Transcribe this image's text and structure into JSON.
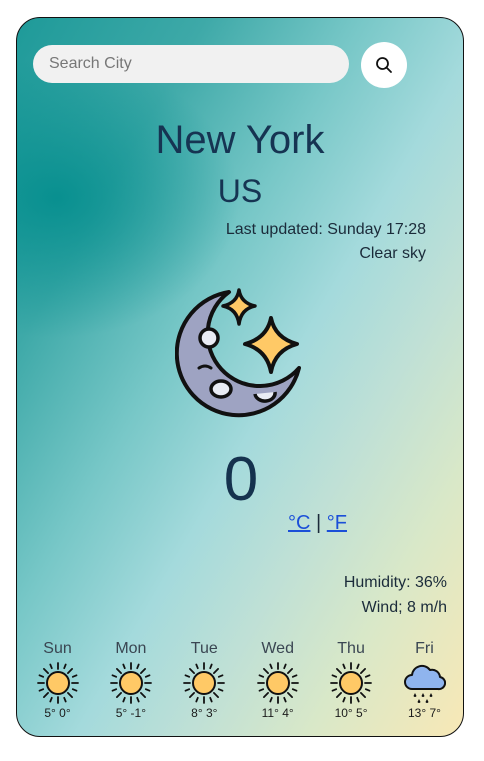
{
  "search": {
    "placeholder": "Search City",
    "value": ""
  },
  "location": {
    "city": "New York",
    "country": "US"
  },
  "current": {
    "last_updated": "Last updated: Sunday 17:28",
    "description": "Clear sky",
    "icon": "crescent-moon-stars-icon",
    "temperature": "0",
    "unit_celsius": "°C",
    "unit_separator": "|",
    "unit_fahrenheit": "°F",
    "humidity": "Humidity: 36%",
    "wind": "Wind; 8 m/h"
  },
  "forecast": [
    {
      "day": "Sun",
      "temps": "5° 0°",
      "icon": "sun-icon"
    },
    {
      "day": "Mon",
      "temps": "5° -1°",
      "icon": "sun-icon"
    },
    {
      "day": "Tue",
      "temps": "8° 3°",
      "icon": "sun-icon"
    },
    {
      "day": "Wed",
      "temps": "11° 4°",
      "icon": "sun-icon"
    },
    {
      "day": "Thu",
      "temps": "10° 5°",
      "icon": "sun-icon"
    },
    {
      "day": "Fri",
      "temps": "13° 7°",
      "icon": "rain-cloud-icon"
    }
  ],
  "colors": {
    "heading": "#163452",
    "link": "#1b4fd8",
    "sun": "#ffc966",
    "moon": "#9ea3c2",
    "star": "#ffc966"
  }
}
